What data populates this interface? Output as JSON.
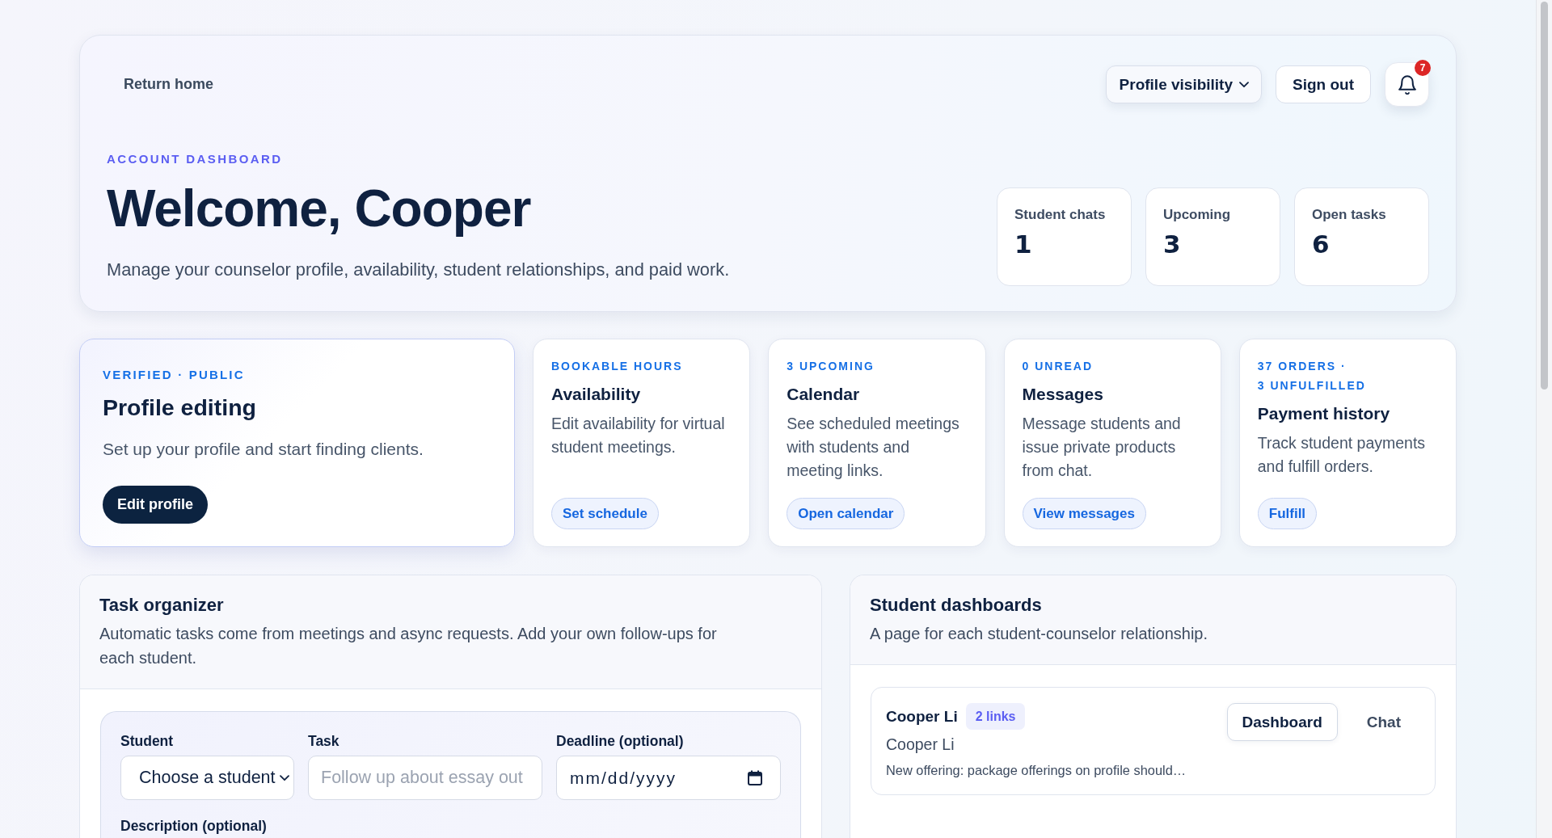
{
  "header": {
    "return_link": "Return home",
    "profile_visibility": "Profile visibility",
    "sign_out": "Sign out",
    "notifications": {
      "count": "7"
    }
  },
  "hero": {
    "eyebrow": "ACCOUNT DASHBOARD",
    "title": "Welcome, Cooper",
    "subtitle": "Manage your counselor profile, availability, student relationships, and paid work.",
    "stats": [
      {
        "label": "Student chats",
        "value": "1"
      },
      {
        "label": "Upcoming",
        "value": "3"
      },
      {
        "label": "Open tasks",
        "value": "6"
      }
    ]
  },
  "cards": [
    {
      "kind": "featured",
      "eyebrow": "VERIFIED · PUBLIC",
      "title": "Profile editing",
      "description": "Set up your profile and start finding clients.",
      "action": "Edit profile"
    },
    {
      "kind": "standard",
      "eyebrow": "BOOKABLE HOURS",
      "title": "Availability",
      "description": "Edit availability for virtual student meetings.",
      "action": "Set schedule"
    },
    {
      "kind": "standard",
      "eyebrow": "3 UPCOMING",
      "title": "Calendar",
      "description": "See scheduled meetings with students and meeting links.",
      "action": "Open calendar"
    },
    {
      "kind": "standard",
      "eyebrow": "0 UNREAD",
      "title": "Messages",
      "description": "Message students and issue private products from chat.",
      "action": "View messages"
    },
    {
      "kind": "standard",
      "eyebrow": "37 ORDERS · 3 UNFULFILLED",
      "title": "Payment history",
      "description": "Track student payments and fulfill orders.",
      "action": "Fulfill"
    }
  ],
  "task_organizer": {
    "title": "Task organizer",
    "description": "Automatic tasks come from meetings and async requests. Add your own follow-ups for each student.",
    "form": {
      "fields": [
        {
          "kind": "select",
          "label": "Student",
          "value": "Choose a student"
        },
        {
          "kind": "text",
          "label": "Task",
          "placeholder": "Follow up about essay out"
        },
        {
          "kind": "date",
          "label": "Deadline (optional)",
          "placeholder": "mm/dd/yyyy"
        }
      ],
      "description_label": "Description (optional)"
    }
  },
  "student_dashboards": {
    "title": "Student dashboards",
    "description": "A page for each student-counselor relationship.",
    "students": [
      {
        "name": "Cooper Li",
        "links": "2 links",
        "subtitle": "Cooper Li",
        "note": "New offering: package offerings on profile should…",
        "actions": [
          {
            "kind": "outline",
            "label": "Dashboard"
          },
          {
            "kind": "ghost",
            "label": "Chat"
          }
        ]
      }
    ]
  }
}
